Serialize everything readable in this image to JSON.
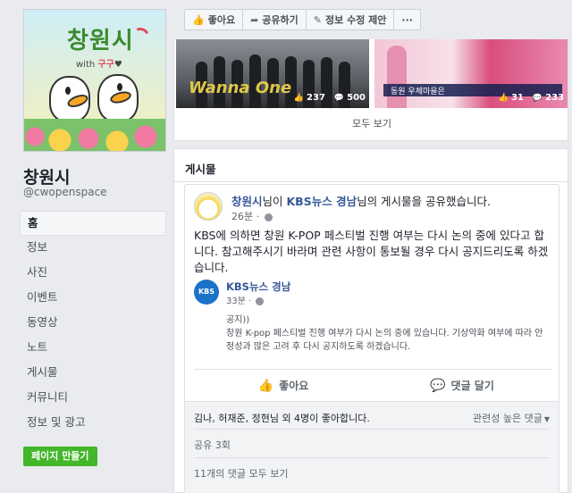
{
  "page": {
    "name": "창원시",
    "handle": "@cwopenspace",
    "logo_text": "창원시",
    "logo_sub_prefix": "with ",
    "logo_sub_highlight": "구구"
  },
  "nav": {
    "items": [
      "홈",
      "정보",
      "사진",
      "이벤트",
      "동영상",
      "노트",
      "게시물",
      "커뮤니티",
      "정보 및 광고"
    ]
  },
  "create_page_label": "페이지 만들기",
  "actionbar": {
    "like": "좋아요",
    "share": "공유하기",
    "suggest_edit": "정보 수정 제안",
    "more": "···"
  },
  "videos": {
    "items": [
      {
        "overlay": "Wanna One",
        "likes": "237",
        "comments": "500"
      },
      {
        "overlay": "동원 우체마을은",
        "likes": "31",
        "comments": "233"
      }
    ],
    "see_all": "모두 보기"
  },
  "posts": {
    "title": "게시물",
    "post": {
      "author": "창원시",
      "header_mid": "님이 ",
      "source": "KBS뉴스 경남",
      "header_tail": "님의 게시물을 공유했습니다.",
      "time": "26분 ·",
      "text": "KBS에 의하면 창원 K-POP 페스티벌 진행 여부는 다시 논의 중에 있다고 합니다. 참고해주시기 바라며 관련 사항이 통보될 경우 다시 공지드리도록 하겠습니다.",
      "shared": {
        "avatar_text": "KBS NEWS",
        "name": "KBS뉴스 경남",
        "time": "33분 ·",
        "text_line1": "공지))",
        "text_line2": "창원 K-pop 페스티벌 진행 여부가 다시 논의 중에 있습니다. 기상악화 여부에 따라 안정성과 많은 고려 후 다시 공지하도록 하겠습니다."
      },
      "like_label": "좋아요",
      "comment_label": "댓글 달기",
      "likes_summary": "김나, 허재준, 정현님 외 4명이 좋아합니다.",
      "relevance": "관련성 높은 댓글",
      "shares": "공유 3회",
      "comments_link": "11개의 댓글 모두 보기"
    }
  }
}
